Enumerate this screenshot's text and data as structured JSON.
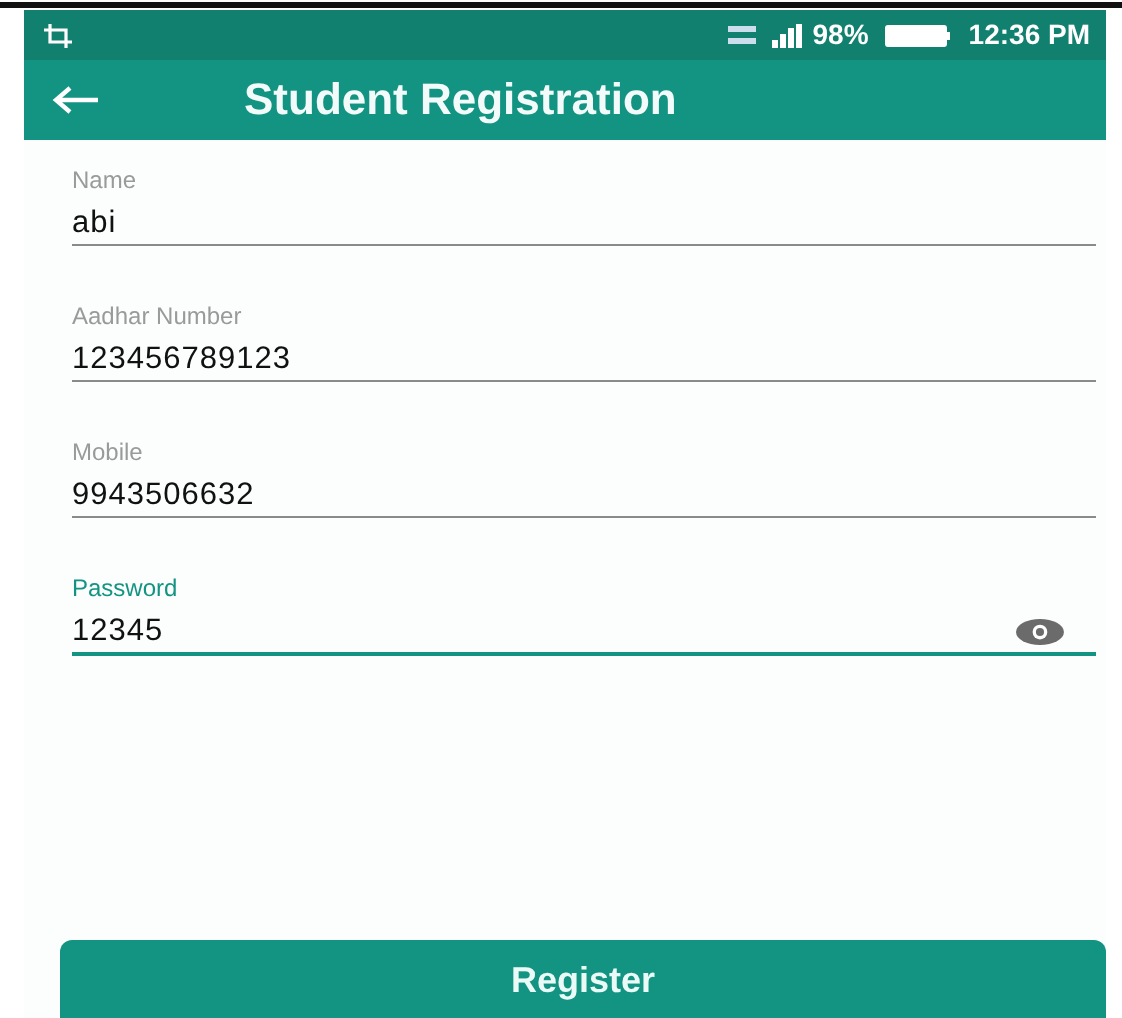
{
  "status_bar": {
    "battery": "98%",
    "time": "12:36 PM"
  },
  "app_bar": {
    "title": "Student Registration"
  },
  "fields": [
    {
      "label": "Name",
      "value": "abi",
      "kind": "text",
      "focused": false
    },
    {
      "label": "Aadhar Number",
      "value": "123456789123",
      "kind": "text",
      "focused": false
    },
    {
      "label": "Mobile",
      "value": "9943506632",
      "kind": "text",
      "focused": false
    },
    {
      "label": "Password",
      "value": "12345",
      "kind": "password",
      "focused": true
    }
  ],
  "buttons": [
    "Register"
  ]
}
